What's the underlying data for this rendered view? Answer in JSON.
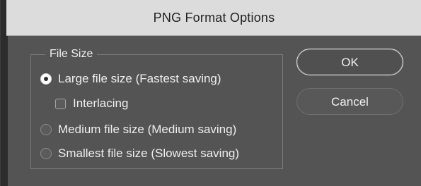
{
  "window": {
    "title": "PNG Format Options"
  },
  "file_size_group": {
    "label": "File Size",
    "options": [
      {
        "label": "Large file size (Fastest saving)",
        "selected": true
      },
      {
        "label": "Medium file size (Medium saving)",
        "selected": false
      },
      {
        "label": "Smallest file size (Slowest saving)",
        "selected": false
      }
    ],
    "interlacing": {
      "label": "Interlacing",
      "checked": false
    }
  },
  "buttons": {
    "ok_label": "OK",
    "cancel_label": "Cancel"
  },
  "colors": {
    "titlebar": "#dcdcdc",
    "dialog_background": "#545454",
    "text": "#efefef"
  },
  "icons": {
    "radio_selected": "radio-selected-icon",
    "radio_unselected": "radio-unselected-icon",
    "checkbox_unchecked": "checkbox-unchecked-icon"
  }
}
